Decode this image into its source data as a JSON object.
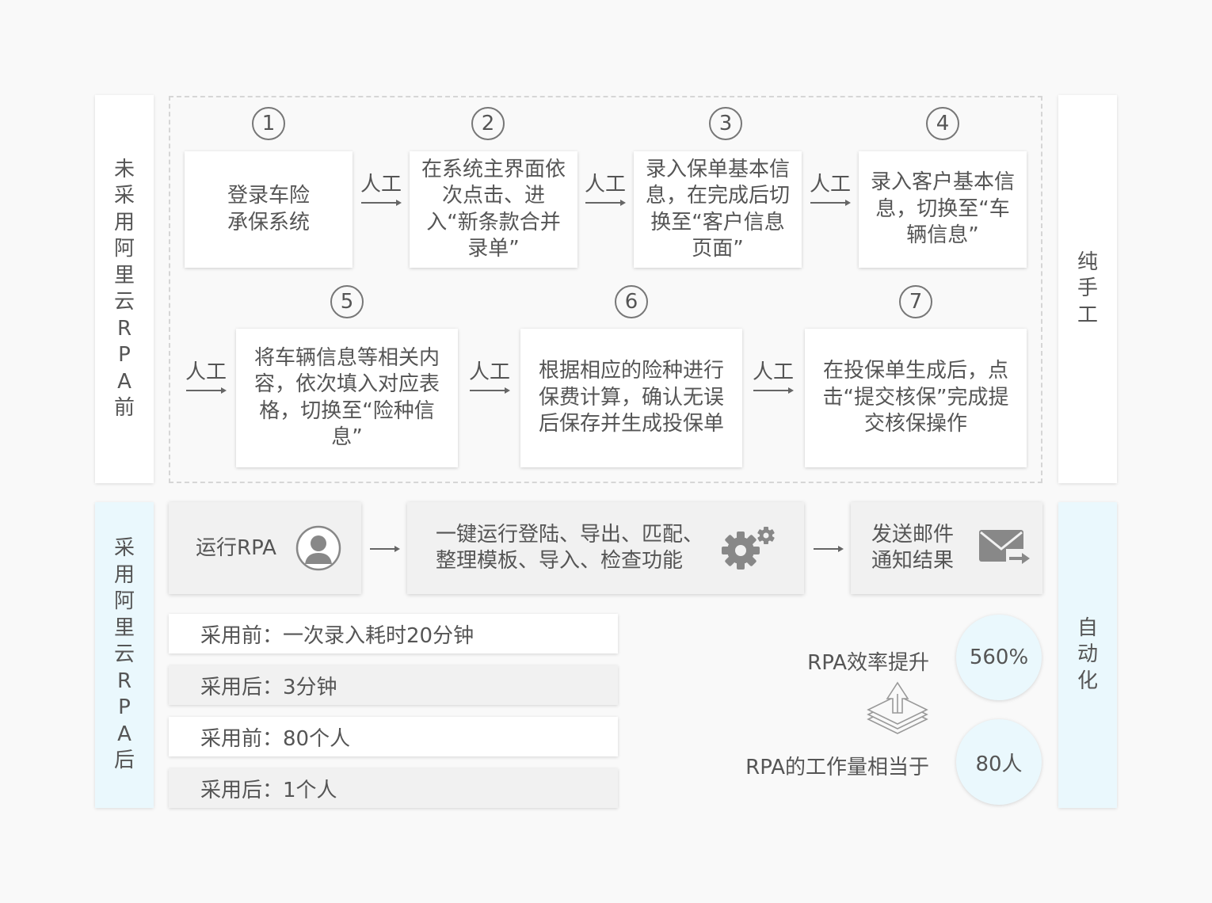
{
  "before_side_label": "未采用阿里云RPA前",
  "after_side_label": "采用阿里云RPA后",
  "manual_label": "纯手工",
  "auto_label": "自动化",
  "connector_label": "人工",
  "steps": [
    {
      "num": "1",
      "text": "登录车险承保系统"
    },
    {
      "num": "2",
      "text": "在系统主界面依次点击、进入“新条款合并录单”"
    },
    {
      "num": "3",
      "text": "录入保单基本信息，在完成后切换至“客户信息页面”"
    },
    {
      "num": "4",
      "text": "录入客户基本信息，切换至“车辆信息”"
    },
    {
      "num": "5",
      "text": "将车辆信息等相关内容，依次填入对应表格，切换至“险种信息”"
    },
    {
      "num": "6",
      "text": "根据相应的险种进行保费计算，确认无误后保存并生成投保单"
    },
    {
      "num": "7",
      "text": "在投保单生成后，点击“提交核保”完成提交核保操作"
    }
  ],
  "rpa_flow": {
    "run": "运行RPA",
    "functions": "一键运行登陆、导出、匹配、整理模板、导入、检查功能",
    "notify": "发送邮件通知结果"
  },
  "stats": [
    "采用前：一次录入耗时20分钟",
    "采用后：3分钟",
    "采用前：80个人",
    "采用后：1个人"
  ],
  "efficiency_label": "RPA效率提升",
  "efficiency_value": "560%",
  "workload_label": "RPA的工作量相当于",
  "workload_value": "80人",
  "colors": {
    "accent_cyan": "#eaf8fd",
    "text": "#555555",
    "icon_gray": "#888888"
  },
  "icons": [
    "user-icon",
    "gears-icon",
    "mail-icon",
    "layers-up-icon"
  ]
}
